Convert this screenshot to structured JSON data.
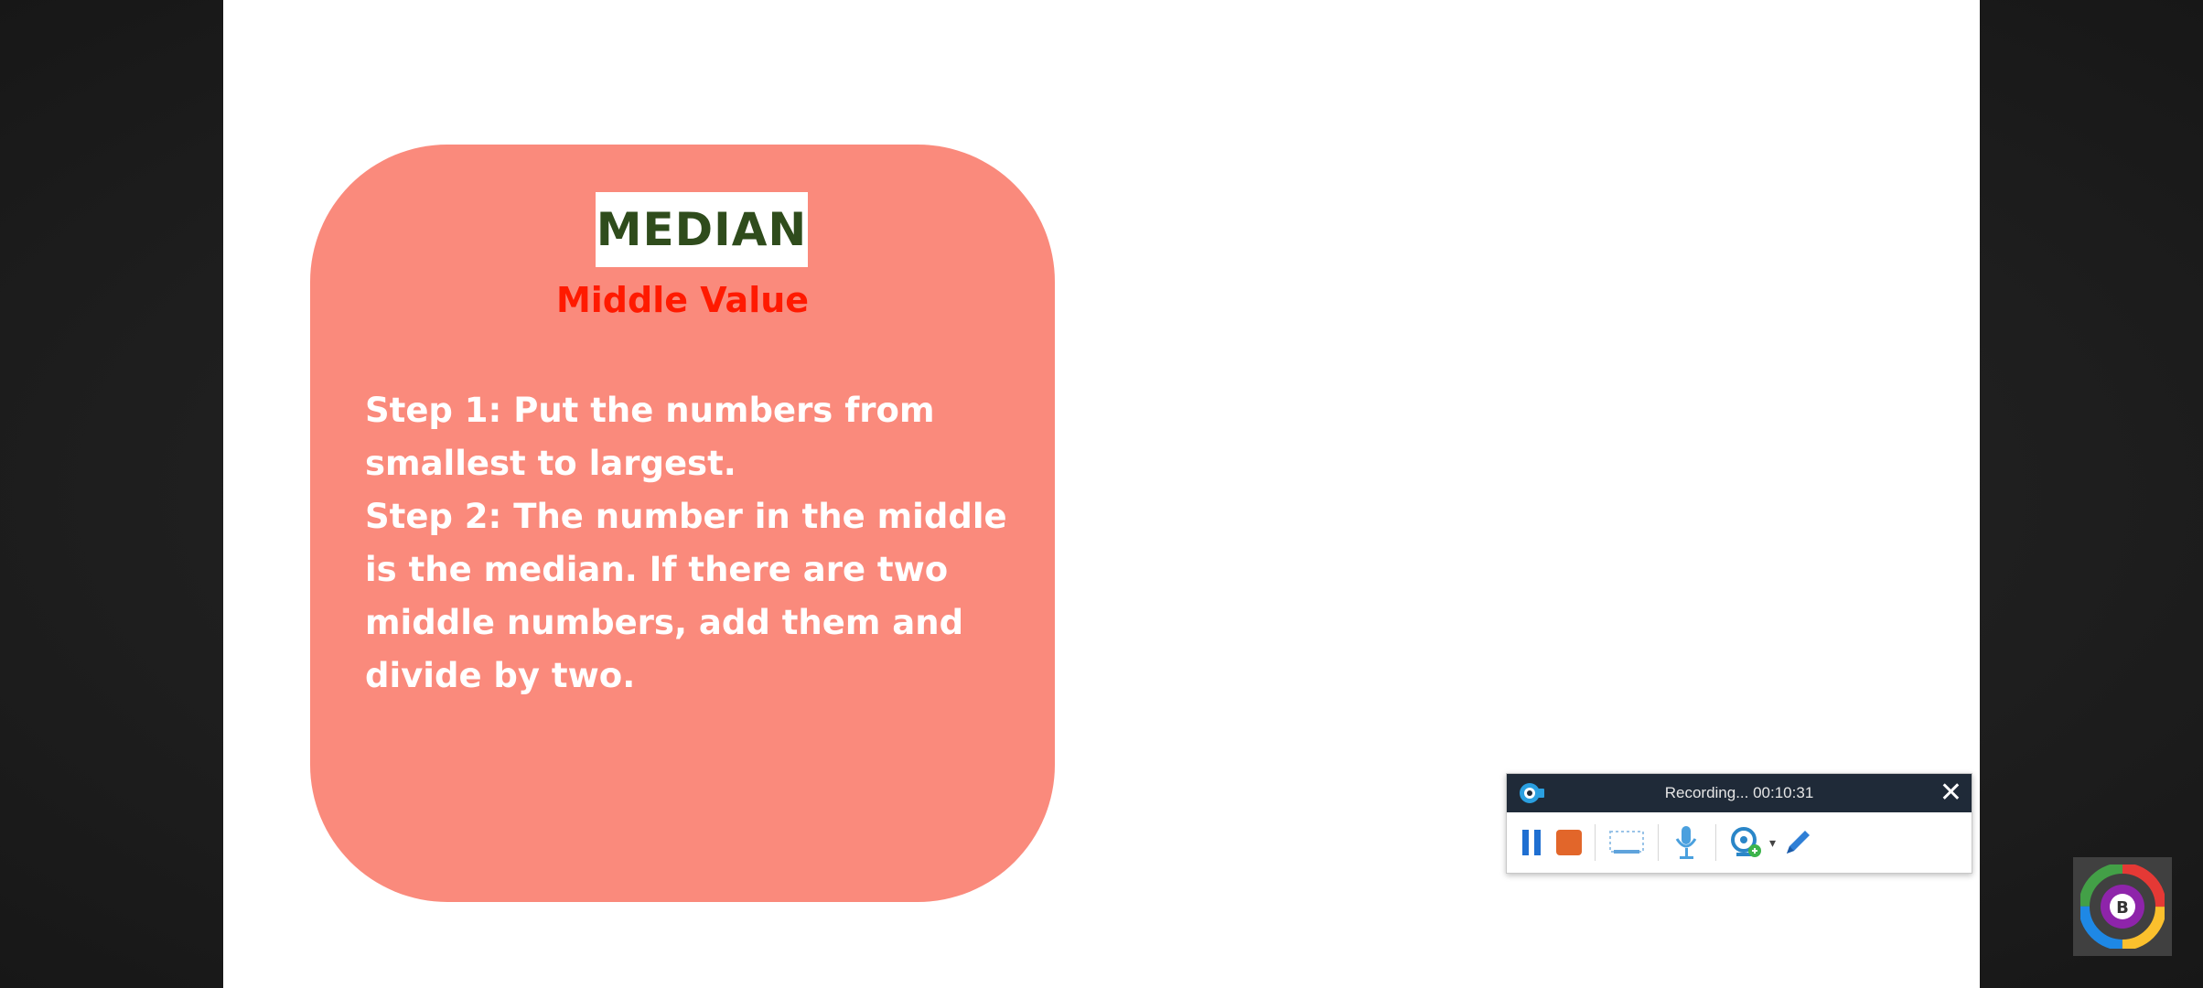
{
  "slide": {
    "title": "MEDIAN",
    "subtitle": "Middle Value",
    "step_lines": [
      "Step 1: Put the numbers from",
      "smallest to largest.",
      "Step 2: The number in the middle",
      "is the median. If there are two",
      "middle numbers, add them and",
      "divide by two."
    ],
    "card_color": "#fa8a7c",
    "title_color": "#2f4c1c",
    "subtitle_color": "#ff1a00"
  },
  "recorder": {
    "status": "Recording... 00:10:31",
    "close_label": "✕",
    "tools": [
      "pause-icon",
      "stop-icon",
      "screen-capture-icon",
      "microphone-icon",
      "webcam-icon",
      "pen-icon"
    ],
    "accent": "#1f6fd1",
    "stop_color": "#e2662a"
  },
  "badge": {
    "letter": "B",
    "icon": "app-logo-icon"
  }
}
